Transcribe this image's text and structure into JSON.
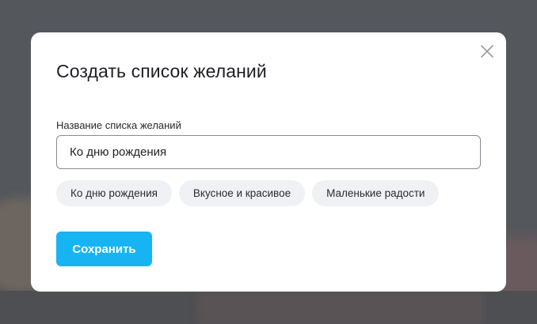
{
  "modal": {
    "title": "Создать список желаний",
    "close_icon": "close-icon",
    "field_label": "Название списка желаний",
    "input_value": "Ко дню рождения",
    "suggestions": [
      "Ко дню рождения",
      "Вкусное и красивое",
      "Маленькие радости"
    ],
    "save_label": "Сохранить"
  },
  "colors": {
    "overlay": "#54575c",
    "primary": "#16b4f2",
    "chip_bg": "#f0f1f5"
  }
}
